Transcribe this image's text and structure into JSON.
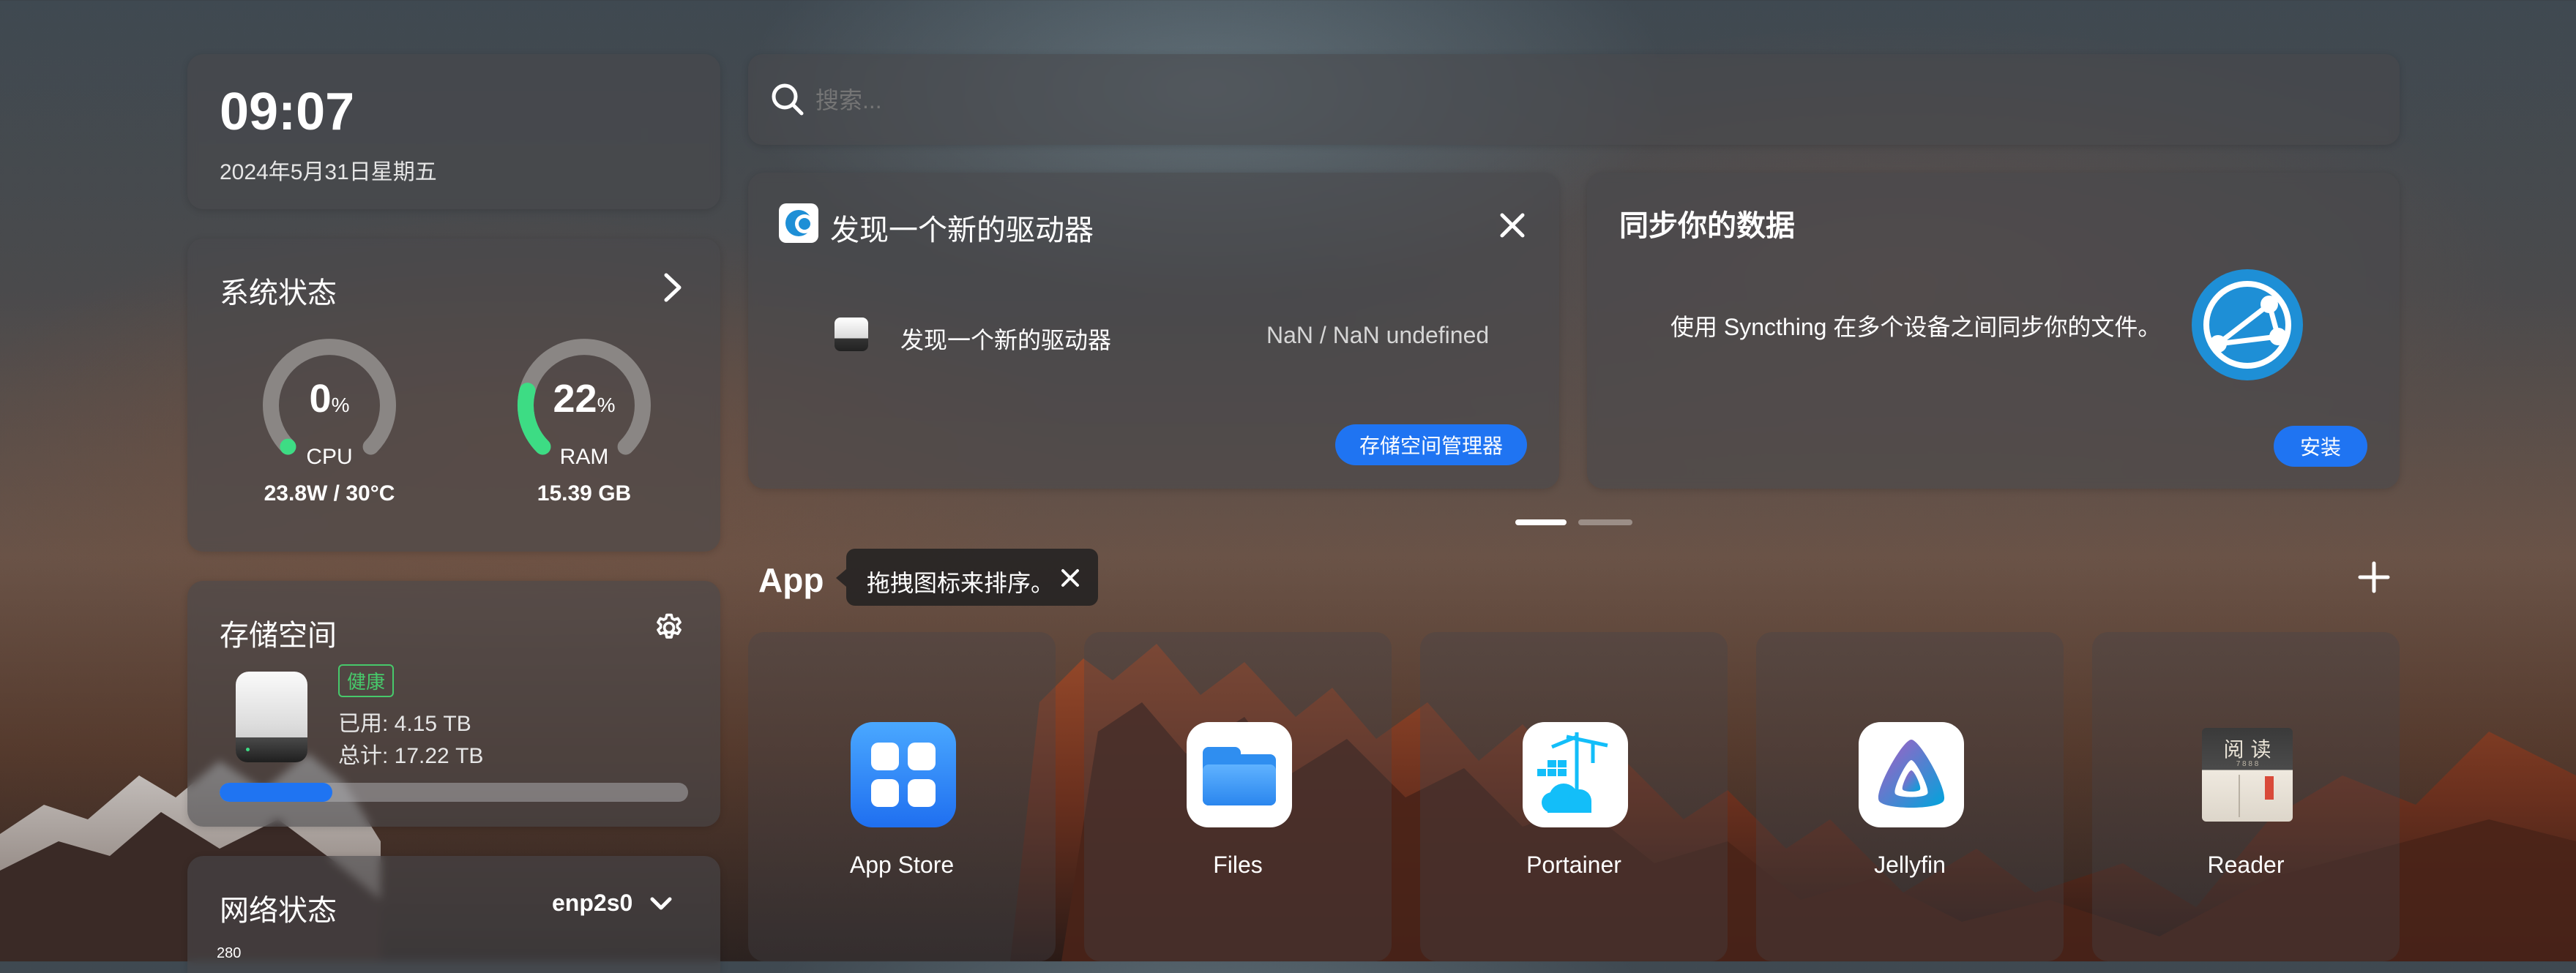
{
  "clock": {
    "time": "09:07",
    "date": "2024年5月31日星期五"
  },
  "search": {
    "placeholder": "搜索..."
  },
  "system_status": {
    "title": "系统状态",
    "cpu": {
      "percent": 0,
      "value": "0",
      "unit": "%",
      "label": "CPU",
      "detail": "23.8W / 30°C"
    },
    "ram": {
      "percent": 22,
      "value": "22",
      "unit": "%",
      "label": "RAM",
      "detail": "15.39 GB"
    }
  },
  "storage": {
    "title": "存储空间",
    "health_badge": "健康",
    "used": "已用: 4.15 TB",
    "total": "总计: 17.22 TB",
    "used_fraction": 0.24
  },
  "network": {
    "title": "网络状态",
    "interface": "enp2s0",
    "axis_top": "280"
  },
  "drive_card": {
    "title": "发现一个新的驱动器",
    "item_name": "发现一个新的驱动器",
    "item_size": "NaN / NaN undefined",
    "button": "存储空间管理器"
  },
  "sync_card": {
    "title": "同步你的数据",
    "description": "使用 Syncthing 在多个设备之间同步你的文件。",
    "button": "安装"
  },
  "apps_section": {
    "title": "App",
    "tooltip": "拖拽图标来排序。",
    "items": [
      {
        "label": "App Store",
        "icon": "app-store-icon"
      },
      {
        "label": "Files",
        "icon": "files-icon"
      },
      {
        "label": "Portainer",
        "icon": "portainer-icon"
      },
      {
        "label": "Jellyfin",
        "icon": "jellyfin-icon"
      },
      {
        "label": "Reader",
        "icon": "reader-icon",
        "icon_text_top": "阅 读",
        "icon_text_sub": "7 8 8 8"
      }
    ]
  },
  "colors": {
    "accent_blue": "#1f74f2",
    "gauge_green": "#3ddc84",
    "health_green": "#47c96b",
    "storage_bar": "#1f74f2",
    "syncthing_blue": "#1e8fd6"
  }
}
